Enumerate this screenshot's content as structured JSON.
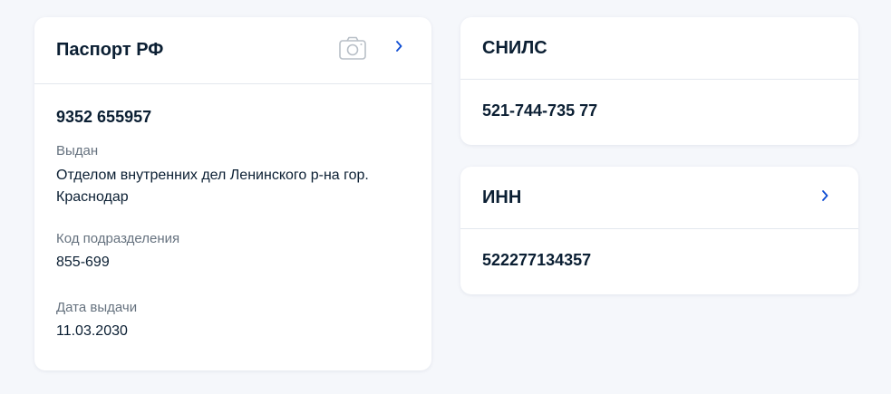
{
  "passport": {
    "title": "Паспорт РФ",
    "number": "9352 655957",
    "issued_label": "Выдан",
    "issued_value": "Отделом внутренних дел Ленинского р-на гор. Краснодар",
    "dept_code_label": "Код подразделения",
    "dept_code_value": "855-699",
    "issue_date_label": "Дата выдачи",
    "issue_date_value": "11.03.2030",
    "icons": [
      "camera-icon",
      "chevron-right-icon"
    ]
  },
  "snils": {
    "title": "СНИЛС",
    "number": "521-744-735 77"
  },
  "inn": {
    "title": "ИНН",
    "number": "522277134357",
    "icons": [
      "chevron-right-icon"
    ]
  },
  "colors": {
    "background": "#f5f7fb",
    "card": "#ffffff",
    "text": "#0b1f33",
    "muted": "#66727f",
    "accent": "#0d4cd3",
    "icon_muted": "#b8bfc7",
    "divider": "#e3e8ee"
  }
}
